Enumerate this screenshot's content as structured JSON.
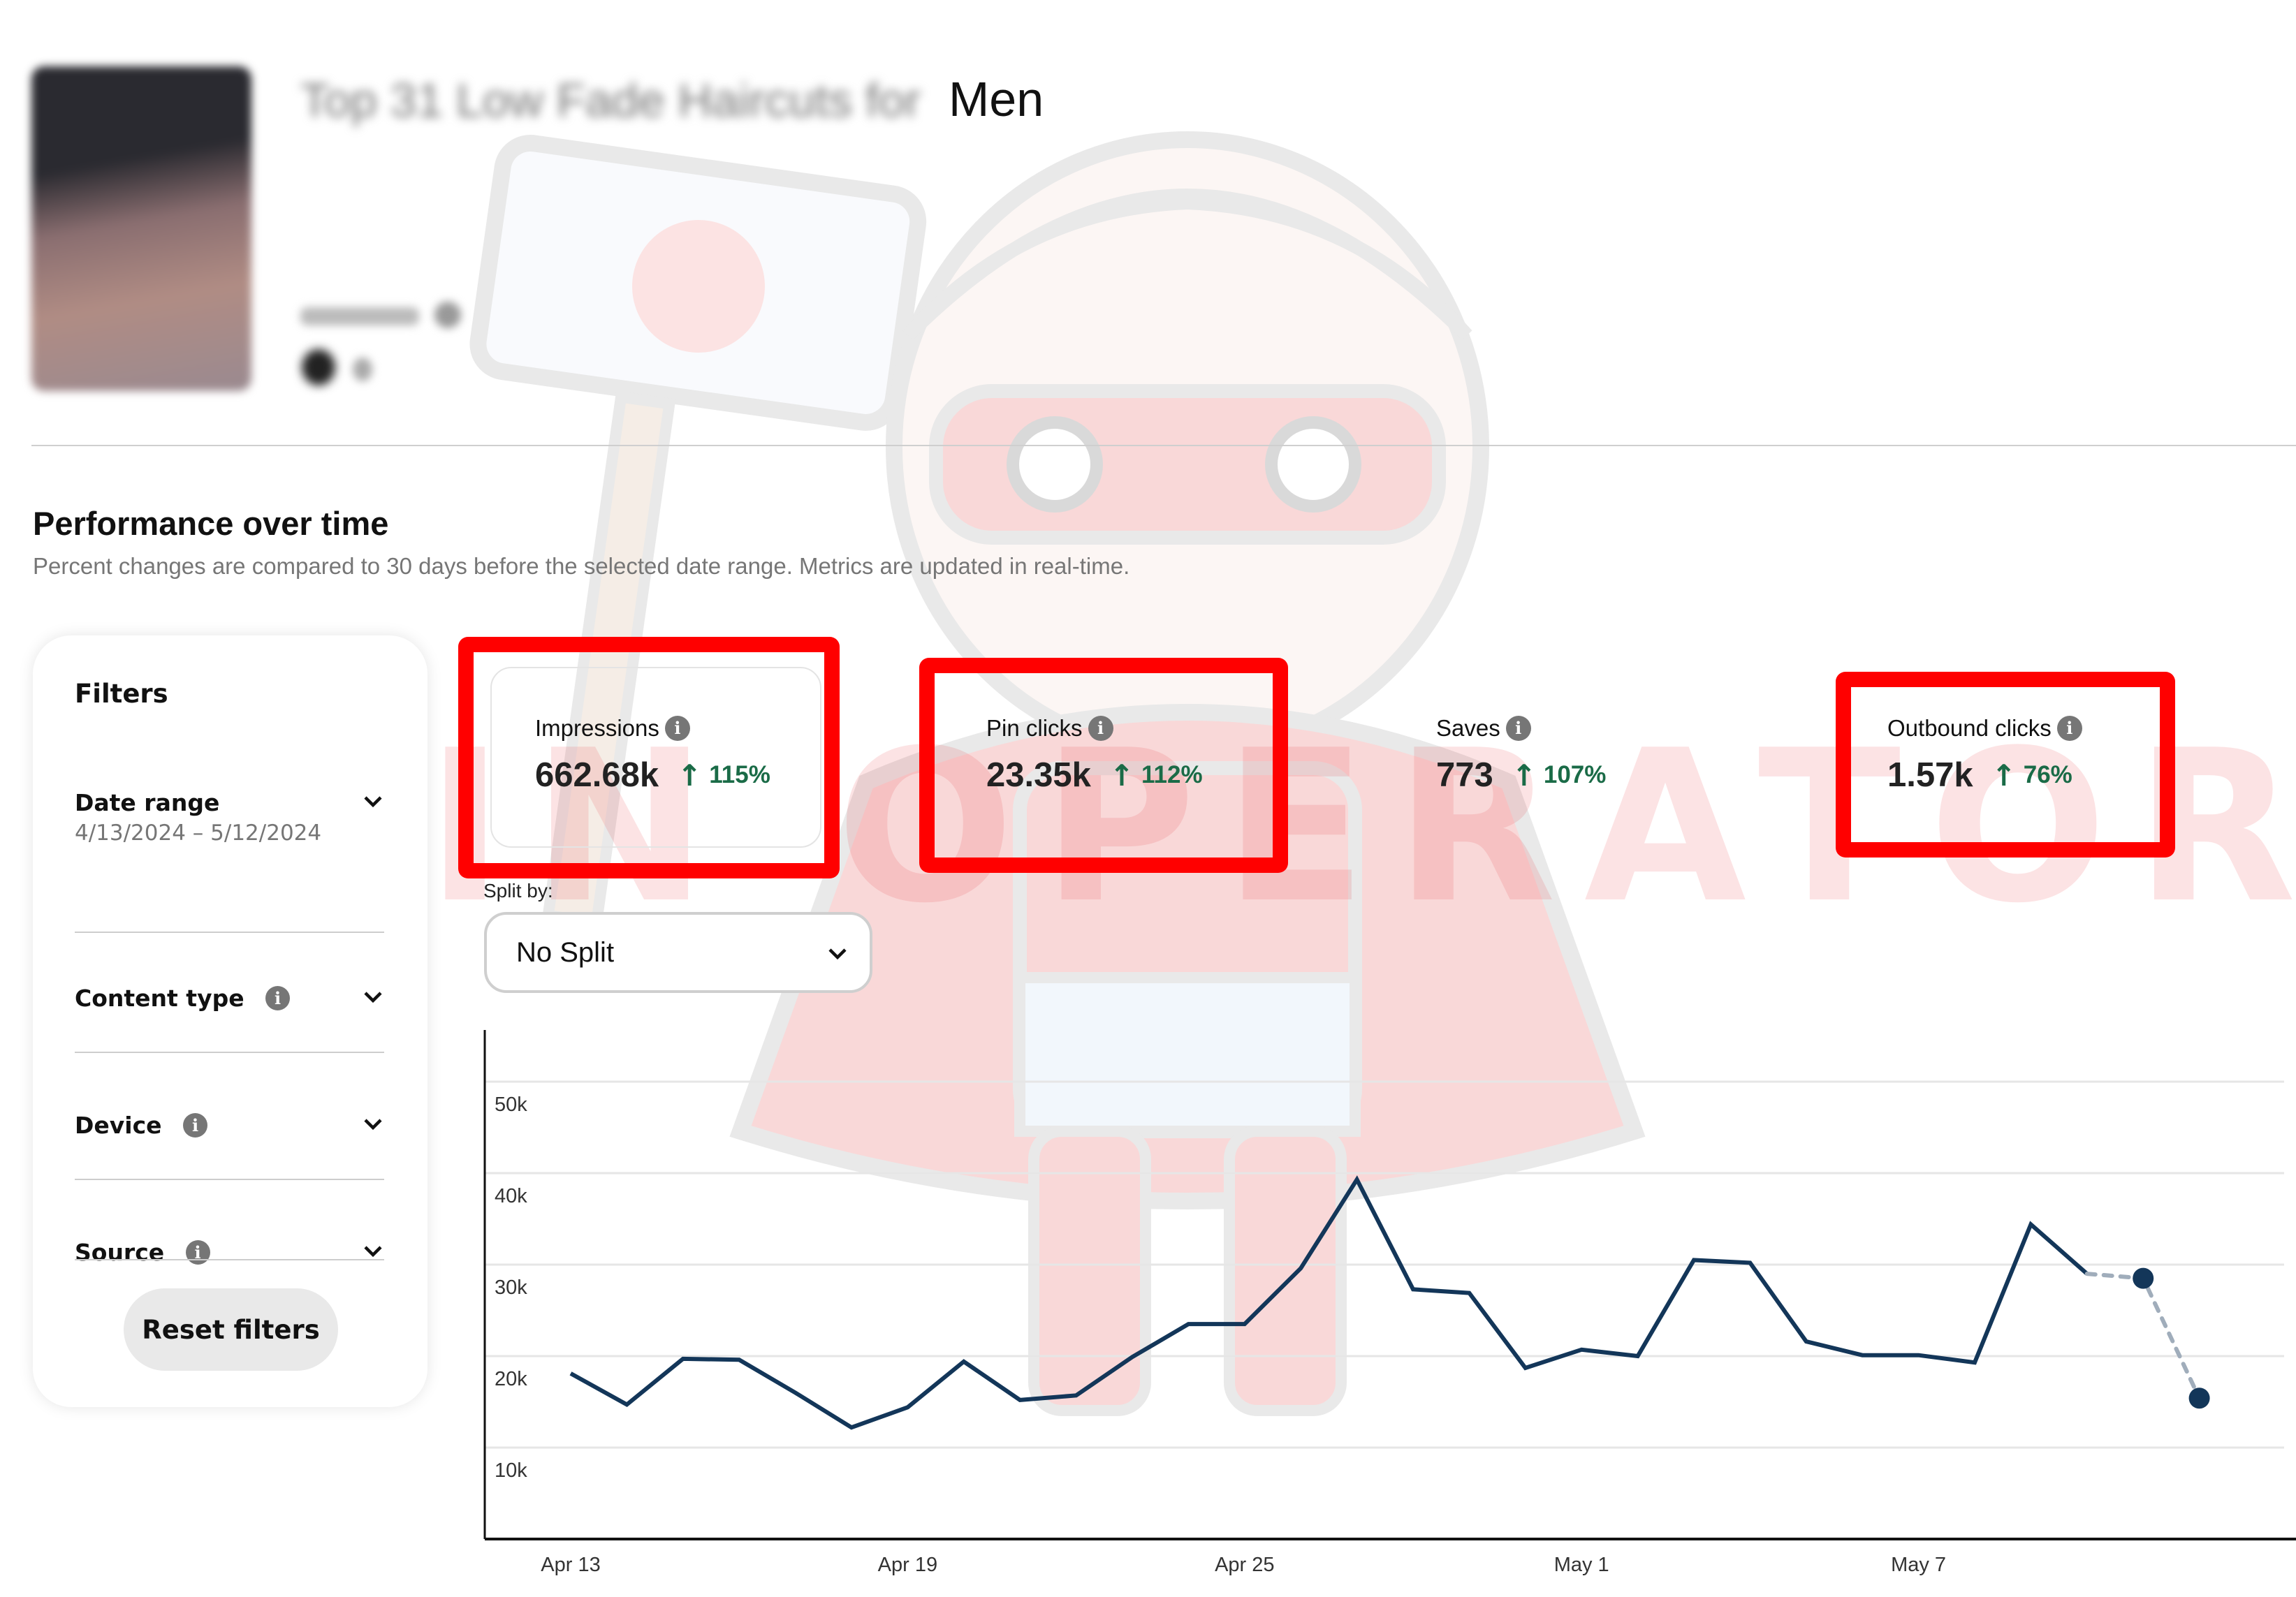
{
  "pin": {
    "title_blurred": "Top 31 Low Fade Haircuts for",
    "title_visible": "Men"
  },
  "watermark": "PIN OPERATOR",
  "section": {
    "title": "Performance over time",
    "subtitle": "Percent changes are compared to 30 days before the selected date range. Metrics are updated in real-time."
  },
  "filters": {
    "title": "Filters",
    "items": [
      {
        "label": "Date range",
        "value": "4/13/2024 – 5/12/2024",
        "has_info": false
      },
      {
        "label": "Content type",
        "has_info": true
      },
      {
        "label": "Device",
        "has_info": true
      },
      {
        "label": "Source",
        "has_info": true
      }
    ],
    "reset_label": "Reset filters"
  },
  "metrics": [
    {
      "label": "Impressions",
      "value": "662.68k",
      "change": "115%",
      "direction": "up",
      "highlighted": true,
      "selected": true
    },
    {
      "label": "Pin clicks",
      "value": "23.35k",
      "change": "112%",
      "direction": "up",
      "highlighted": true,
      "selected": false
    },
    {
      "label": "Saves",
      "value": "773",
      "change": "107%",
      "direction": "up",
      "highlighted": false,
      "selected": false
    },
    {
      "label": "Outbound clicks",
      "value": "1.57k",
      "change": "76%",
      "direction": "up",
      "highlighted": true,
      "selected": false
    }
  ],
  "split": {
    "label": "Split by:",
    "value": "No Split"
  },
  "icons": {
    "info": "i",
    "trend_up": "↑"
  },
  "colors": {
    "line": "#133659",
    "line_estimated": "#a0adbb",
    "trend_up": "#1a6b47",
    "highlight": "#ff0000"
  },
  "chart_data": {
    "type": "line",
    "title": "",
    "xlabel": "",
    "ylabel": "",
    "x": [
      "Apr 13",
      "Apr 14",
      "Apr 15",
      "Apr 16",
      "Apr 17",
      "Apr 18",
      "Apr 19",
      "Apr 20",
      "Apr 21",
      "Apr 22",
      "Apr 23",
      "Apr 24",
      "Apr 25",
      "Apr 26",
      "Apr 27",
      "Apr 28",
      "Apr 29",
      "Apr 30",
      "May 1",
      "May 2",
      "May 3",
      "May 4",
      "May 5",
      "May 6",
      "May 7",
      "May 8",
      "May 9",
      "May 10",
      "May 11",
      "May 12"
    ],
    "x_tick_labels": [
      "Apr 13",
      "Apr 19",
      "Apr 25",
      "May 1",
      "May 7"
    ],
    "y_tick_labels": [
      "10k",
      "20k",
      "30k",
      "40k",
      "50k"
    ],
    "y_ticks": [
      10000,
      20000,
      30000,
      40000,
      50000
    ],
    "ylim": [
      0,
      55000
    ],
    "grid": true,
    "legend": "none",
    "series": [
      {
        "name": "Impressions",
        "values": [
          18100,
          14700,
          19700,
          19600,
          16000,
          12200,
          14400,
          19400,
          15200,
          15700,
          19900,
          23500,
          23500,
          29600,
          39300,
          27300,
          26900,
          18700,
          20700,
          20000,
          30500,
          30200,
          21600,
          20100,
          20100,
          19300,
          34400,
          29000,
          28500,
          15400
        ],
        "estimated_from_index": 27
      }
    ]
  }
}
